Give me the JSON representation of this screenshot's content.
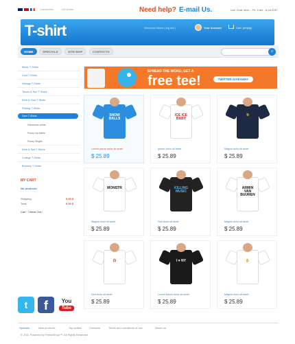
{
  "topbar": {
    "currency": "Currencies:",
    "currency_val": "US Dollar",
    "need_help": "Need help?",
    "email_us": "E-mail Us.",
    "live_chat": "Live Chat: Mon. - Fri. 9 am - 6 pm EST"
  },
  "header": {
    "logo": "T-shirt",
    "welcome": "Welcome Adam ( log out )",
    "account": "Your Account",
    "cart": "Cart: (empty)"
  },
  "nav": {
    "tabs": [
      "HOME",
      "SPECIALS",
      "SITE MAP",
      "CONTACTS"
    ],
    "search_placeholder": ""
  },
  "sidebar": {
    "categories": [
      "Music T-Shirts",
      "Cool T-Shirts",
      "Vintage T-Shirts",
      "Tennis & Surf T-Shirts",
      "Dine & Club T-Shirts",
      "Fishing T-Shirts",
      "Dice T-Shirts",
      "Dine & Surf T-Shirts",
      "College T-Shirts",
      "Brewery T-Shirts"
    ],
    "active_index": 6,
    "subcategories": [
      "Humorous prints",
      "Funny my shirts",
      "Funny Singlts"
    ]
  },
  "cart": {
    "title": "MY CART",
    "empty": "No products",
    "rows": [
      {
        "label": "Shipping",
        "value": "0.00 $"
      },
      {
        "label": "Total",
        "value": "0.00 $"
      }
    ],
    "links": "Cart  ·  Check Out  ›"
  },
  "banner": {
    "line1": "SPREAD THE WORD, GET A",
    "line2": "free tee!",
    "button": "TWITTER GIVEAWAY"
  },
  "social": {
    "twitter": "t",
    "facebook": "f",
    "youtube_top": "You",
    "youtube_bottom": "Tube"
  },
  "products": [
    {
      "name": "Lorem ipsum dolor sit amet",
      "price": "$ 25.89",
      "color": "#2d8ee0",
      "print": "SNOW BALLS",
      "print_color": "#fff",
      "hl": true
    },
    {
      "name": "Ipsum dolor sit amet",
      "price": "$ 25.89",
      "color": "#ffffff",
      "print": "ICE ICE BABY",
      "print_color": "#d0242a",
      "hl": false
    },
    {
      "name": "Magna dolor sit amet",
      "price": "$ 25.89",
      "color": "#1e2a44",
      "print": "☃",
      "print_color": "#f2d24a",
      "hl": false
    },
    {
      "name": "Magna dolor sit amet",
      "price": "$ 25.89",
      "color": "#ffffff",
      "print": "MONSTR",
      "print_color": "#111",
      "hl": false
    },
    {
      "name": "Sed dolor sit amet",
      "price": "$ 25.89",
      "color": "#222222",
      "print": "KILLING MUSIC",
      "print_color": "#5bb5ea",
      "hl": false
    },
    {
      "name": "Magna dolor sit amet",
      "price": "$ 25.89",
      "color": "#ffffff",
      "print": "ARMIN VAN BUUREN",
      "print_color": "#111",
      "hl": false
    },
    {
      "name": "Sed dolor sit amet",
      "price": "$ 25.89",
      "color": "#ffffff",
      "print": "ᗣ",
      "print_color": "#e02020",
      "hl": false
    },
    {
      "name": "Lorem ipsum dolor sit amet",
      "price": "$ 25.89",
      "color": "#1a1a1a",
      "print": "I ♥ NY",
      "print_color": "#fff",
      "hl": false
    },
    {
      "name": "Magna dolor sit amet",
      "price": "$ 25.89",
      "color": "#ffffff",
      "print": "✋",
      "print_color": "#d42020",
      "hl": false
    }
  ],
  "footer": {
    "links": [
      "Specials",
      "New products",
      "Top sellers",
      "Contacts",
      "Terms and conditions of use",
      "About us"
    ],
    "copyright": "© 2011 Powered by PrestaShop™. All Rights Reserved"
  }
}
